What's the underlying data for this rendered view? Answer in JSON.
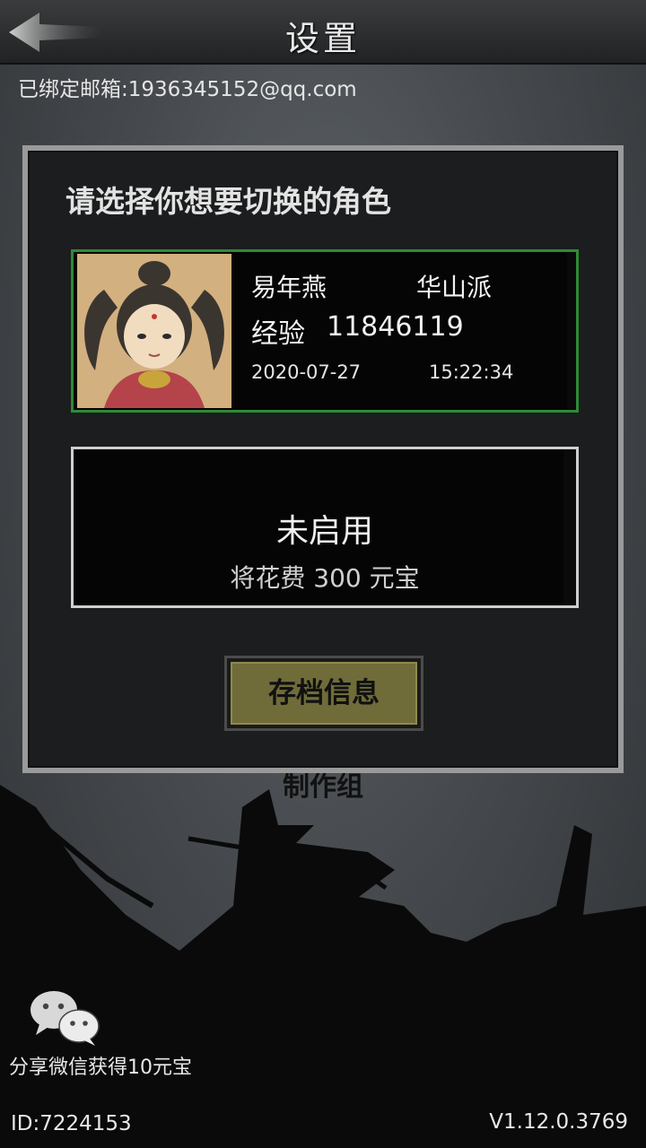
{
  "header": {
    "title": "设置"
  },
  "account": {
    "email_text": "已绑定邮箱:1936345152@qq.com"
  },
  "credits_text": "制作组",
  "dialog": {
    "prompt": "请选择你想要切换的角色",
    "slot1": {
      "name": "易年燕",
      "school": "华山派",
      "exp_label": "经验",
      "exp_value": "11846119",
      "date": "2020-07-27",
      "time": "15:22:34",
      "border_color": "#2f8a36"
    },
    "slot2": {
      "title": "未启用",
      "cost": "将花费 300 元宝"
    },
    "save_info_button": "存档信息"
  },
  "share": {
    "label": "分享微信获得10元宝",
    "icon": "wechat-icon"
  },
  "footer": {
    "id_text": "ID:7224153",
    "version": "V1.12.0.3769"
  }
}
